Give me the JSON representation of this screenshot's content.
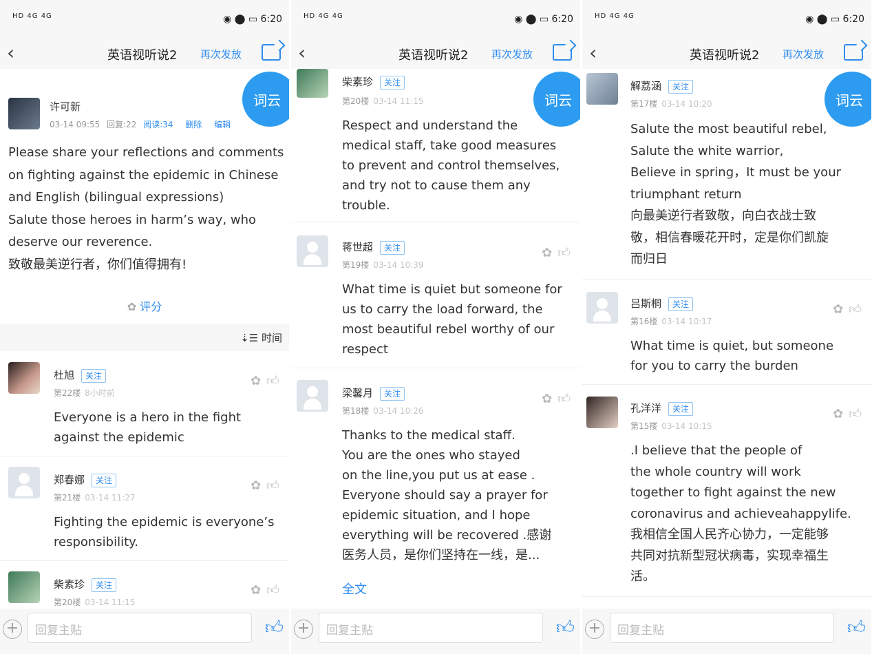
{
  "status": {
    "left": "HD 4G 4G",
    "right": "6:20"
  },
  "nav": {
    "title": "英语视听说2",
    "resend": "再次发放"
  },
  "fab": "词云",
  "bottom": {
    "plus": "+",
    "reply_placeholder": "回复主贴"
  },
  "panel1": {
    "post": {
      "author": "许可新",
      "time": "03-14 09:55",
      "replies": "回复:22",
      "reads": "阅读:34",
      "delete": "删除",
      "edit": "编辑",
      "lines": [
        "Please share your reflections and comments",
        "on fighting against the epidemic in Chinese",
        "and English (bilingual expressions)",
        "Salute those heroes in harm’s way, who",
        "deserve our reverence.",
        "致敬最美逆行者，你们值得拥有!"
      ],
      "rating": "评分"
    },
    "sort": "时间",
    "comments": [
      {
        "name": "杜旭",
        "follow": "关注",
        "floor": "第22楼",
        "time": "8小时前",
        "lines": [
          "Everyone is a hero in the fight",
          "against the epidemic"
        ]
      },
      {
        "name": "郑春娜",
        "follow": "关注",
        "floor": "第21楼",
        "time": "03-14 11:27",
        "lines": [
          "Fighting the epidemic is everyone’s",
          "responsibility."
        ]
      },
      {
        "name": "柴素珍",
        "follow": "关注",
        "floor": "第20楼",
        "time": "03-14 11:15"
      }
    ]
  },
  "panel2": {
    "comments": [
      {
        "name": "柴素珍",
        "follow": "关注",
        "floor": "第20楼",
        "time": "03-14 11:15",
        "lines": [
          "Respect and understand the",
          "medical staff, take good measures",
          "to prevent and control themselves,",
          "and try not to cause them any",
          "trouble."
        ]
      },
      {
        "name": "蒋世超",
        "follow": "关注",
        "floor": "第19楼",
        "time": "03-14 10:39",
        "lines": [
          "What time is quiet but someone for",
          "us to carry the load forward, the",
          "most beautiful rebel worthy of our",
          "respect"
        ]
      },
      {
        "name": "梁馨月",
        "follow": "关注",
        "floor": "第18楼",
        "time": "03-14 10:26",
        "lines": [
          "Thanks to the medical staff.",
          "You are the ones who stayed",
          "on the line,you put us at ease .",
          "Everyone should say a prayer for",
          "epidemic situation, and I hope",
          "everything will be recovered .感谢",
          "医务人员，是你们坚持在一线，是..."
        ],
        "more": "全文"
      }
    ]
  },
  "panel3": {
    "comments": [
      {
        "name": "解荔涵",
        "follow": "关注",
        "floor": "第17楼",
        "time": "03-14 10:20",
        "lines": [
          "Salute the most beautiful rebel,",
          "Salute the white warrior,",
          "Believe in spring，It must be your",
          "triumphant return",
          "向最美逆行者致敬，向白衣战士致",
          "敬，相信春暖花开时，定是你们凯旋",
          "而归日"
        ]
      },
      {
        "name": "吕斯桐",
        "follow": "关注",
        "floor": "第16楼",
        "time": "03-14 10:17",
        "lines": [
          "What time is quiet, but someone",
          "for you to carry the burden"
        ]
      },
      {
        "name": "孔洋洋",
        "follow": "关注",
        "floor": "第15楼",
        "time": "03-14 10:15",
        "lines": [
          ".I believe that the people of",
          "the whole country will work",
          "together to fight against the new",
          "coronavirus and achieveahappylife.",
          "我相信全国人民齐心协力，一定能够",
          "共同对抗新型冠状病毒，实现幸福生",
          "活。"
        ]
      }
    ]
  }
}
